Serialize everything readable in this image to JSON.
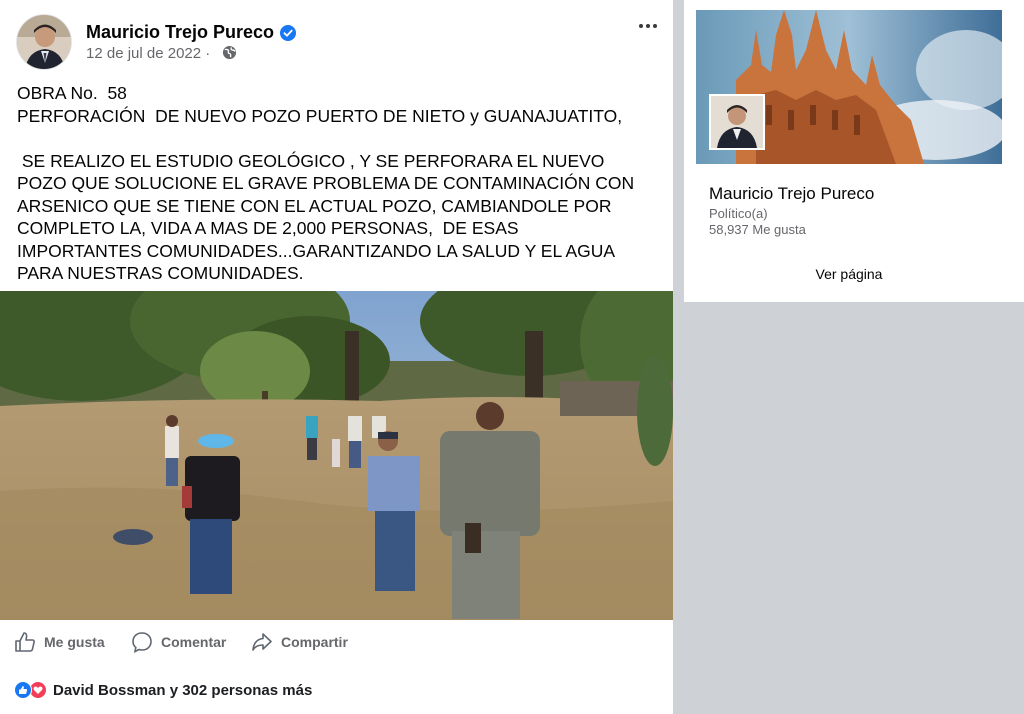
{
  "post": {
    "author": "Mauricio Trejo Pureco",
    "date": "12 de jul de 2022 ·",
    "text_lines": [
      "OBRA No.  58",
      "PERFORACIÓN  DE NUEVO POZO PUERTO DE NIETO y GUANAJUATITO,",
      "",
      " SE REALIZO EL ESTUDIO GEOLÓGICO , Y SE PERFORARA EL NUEVO",
      "POZO QUE SOLUCIONE EL GRAVE PROBLEMA DE CONTAMINACIÓN CON",
      "ARSENICO QUE SE TIENE CON EL ACTUAL POZO, CAMBIANDOLE POR",
      "COMPLETO LA, VIDA A MAS DE 2,000 PERSONAS,  DE ESAS",
      "IMPORTANTES COMUNIDADES...GARANTIZANDO LA SALUD Y EL AGUA",
      "PARA NUESTRAS COMUNIDADES."
    ],
    "actions": {
      "like": "Me gusta",
      "comment": "Comentar",
      "share": "Compartir"
    },
    "reactions_summary": "David Bossman y 302 personas más",
    "icons": {
      "verified": "verified-badge-icon",
      "privacy": "globe-icon",
      "more": "more-options-icon",
      "like": "thumbs-up-icon",
      "comment": "comment-bubble-icon",
      "share": "share-arrow-icon"
    }
  },
  "page_card": {
    "name": "Mauricio Trejo Pureco",
    "category": "Político(a)",
    "likes": "58,937 Me gusta",
    "cta": "Ver página"
  },
  "colors": {
    "facebook_blue": "#1877f2",
    "love_red": "#f33e58",
    "secondary_text": "#65676b",
    "background_gray": "#ced1d6"
  }
}
